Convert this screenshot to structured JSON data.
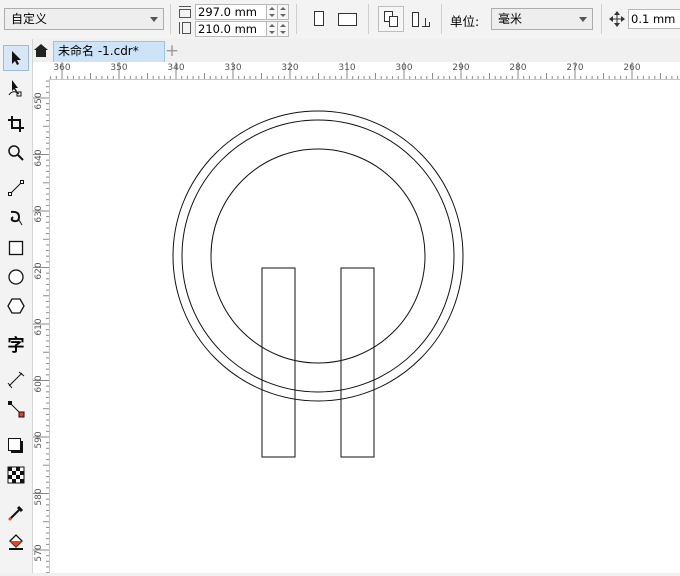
{
  "property_bar": {
    "preset": "自定义",
    "page_width": "297.0 mm",
    "page_height": "210.0 mm",
    "units_label": "单位:",
    "units_value": "毫米",
    "nudge_value": "0.1 mm"
  },
  "tabs": [
    {
      "label": "未命名 -1.cdr*"
    }
  ],
  "toolbox": [
    "pick-tool",
    "shape-tool",
    "crop-tool",
    "zoom-tool",
    "freehand-tool",
    "artistic-media-tool",
    "rectangle-tool",
    "ellipse-tool",
    "polygon-tool",
    "text-tool",
    "parallel-dimension-tool",
    "connector-tool",
    "drop-shadow-tool",
    "transparency-tool",
    "color-eyedropper-tool",
    "interactive-fill-tool"
  ],
  "ruler": {
    "horizontal": [
      "360",
      "350",
      "340",
      "330",
      "320",
      "310",
      "300",
      "290",
      "280",
      "270",
      "260"
    ],
    "vertical": [
      "650",
      "640",
      "630",
      "620",
      "610",
      "600",
      "590",
      "580",
      "570"
    ]
  }
}
